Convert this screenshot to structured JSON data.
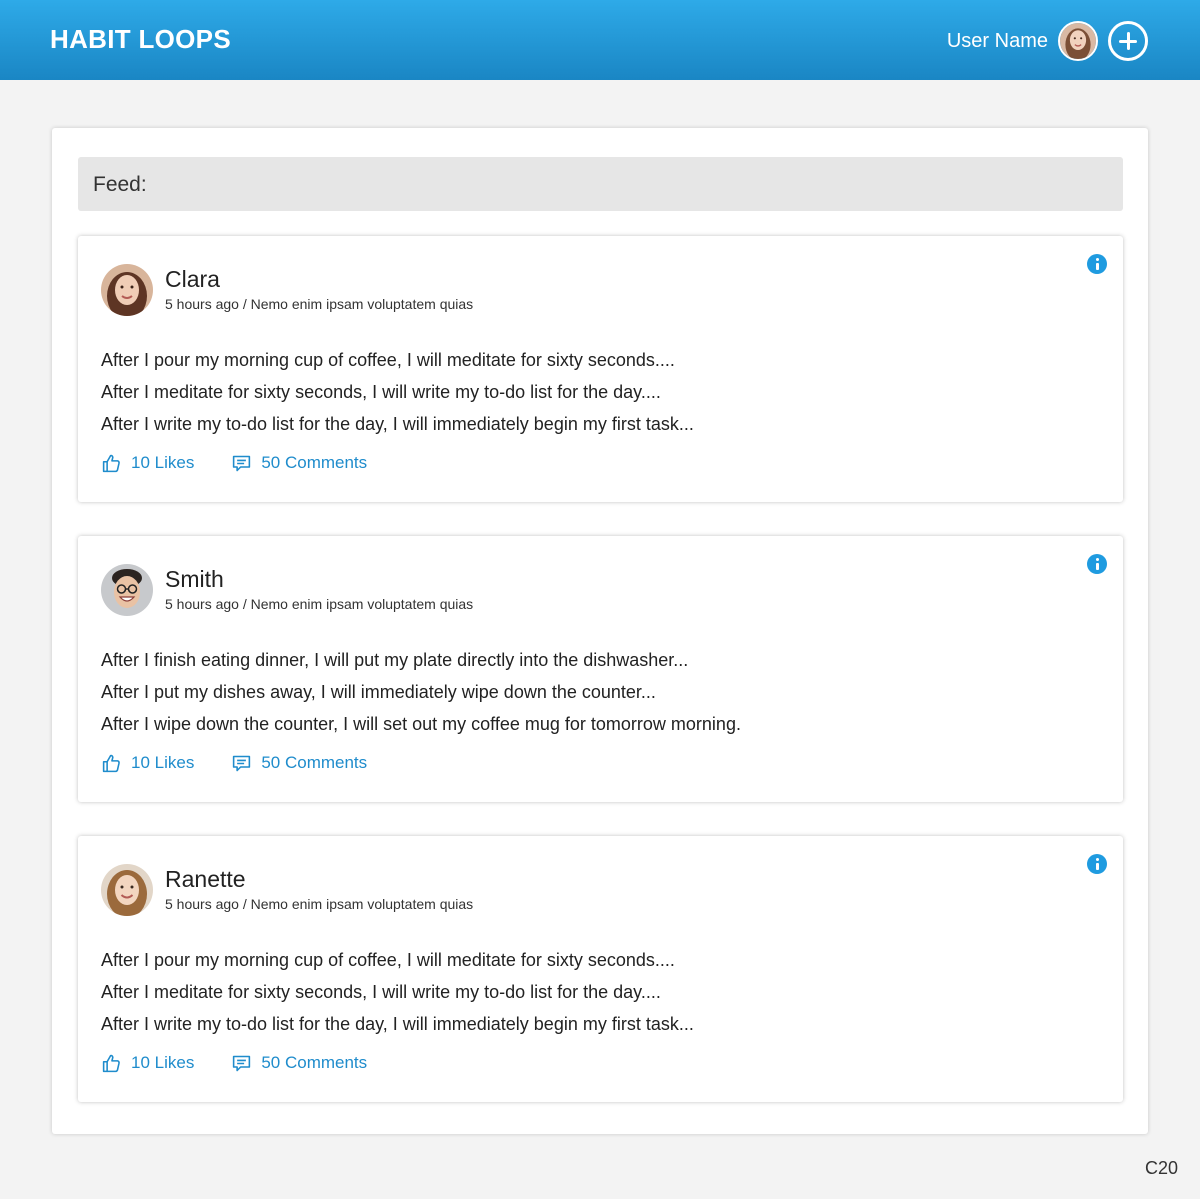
{
  "header": {
    "title": "HABIT LOOPS",
    "user_name": "User Name",
    "accent_color": "#1f9be0"
  },
  "feed": {
    "label": "Feed:",
    "posts": [
      {
        "author": "Clara",
        "meta": "5 hours ago / Nemo enim ipsam voluptatem quias",
        "lines": [
          "After I pour my morning cup of coffee, I will meditate for sixty seconds....",
          "After I meditate for sixty seconds, I will write my to-do list for the day....",
          "After I write my to-do list for the day, I will immediately begin my first task..."
        ],
        "likes": "10 Likes",
        "comments": "50 Comments"
      },
      {
        "author": "Smith",
        "meta": "5 hours ago / Nemo enim ipsam voluptatem quias",
        "lines": [
          "After I finish eating dinner, I will put my plate directly into the dishwasher...",
          "After I put my dishes away, I will immediately wipe down the counter...",
          "After I wipe down the counter, I will set out my coffee mug for tomorrow morning."
        ],
        "likes": "10 Likes",
        "comments": "50 Comments"
      },
      {
        "author": "Ranette",
        "meta": "5 hours ago / Nemo enim ipsam voluptatem quias",
        "lines": [
          "After I pour my morning cup of coffee, I will meditate for sixty seconds....",
          "After I meditate for sixty seconds, I will write my to-do list for the day....",
          "After I write my to-do list for the day, I will immediately begin my first task..."
        ],
        "likes": "10 Likes",
        "comments": "50 Comments"
      }
    ]
  },
  "footer": {
    "code": "C20"
  }
}
